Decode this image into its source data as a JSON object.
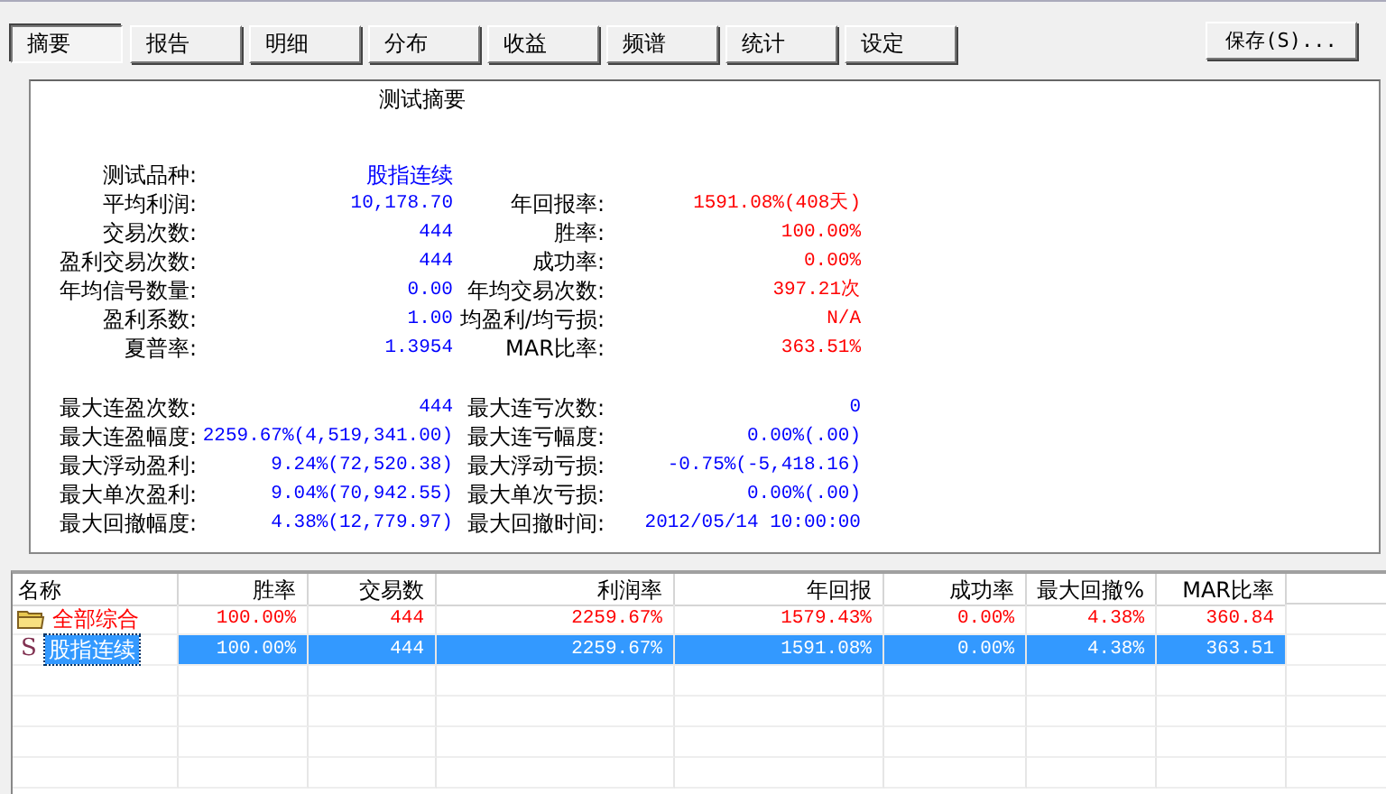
{
  "tabs": [
    {
      "label": "摘要",
      "selected": true
    },
    {
      "label": "报告",
      "selected": false
    },
    {
      "label": "明细",
      "selected": false
    },
    {
      "label": "分布",
      "selected": false
    },
    {
      "label": "收益",
      "selected": false
    },
    {
      "label": "频谱",
      "selected": false
    },
    {
      "label": "统计",
      "selected": false
    },
    {
      "label": "设定",
      "selected": false
    }
  ],
  "save_button": "保存(S)...",
  "summary": {
    "title": "测试摘要",
    "groups": [
      [
        [
          {
            "label": "测试品种:",
            "value": "股指连续",
            "color": "#0000ff"
          }
        ],
        [
          {
            "label": "平均利润:",
            "value": "10,178.70",
            "color": "#0000ff"
          },
          {
            "label": "年回报率:",
            "value": "1591.08%(408天)",
            "color": "#ff0000"
          }
        ],
        [
          {
            "label": "交易次数:",
            "value": "444",
            "color": "#0000ff"
          },
          {
            "label": "胜率:",
            "value": "100.00%",
            "color": "#ff0000"
          }
        ],
        [
          {
            "label": "盈利交易次数:",
            "value": "444",
            "color": "#0000ff"
          },
          {
            "label": "成功率:",
            "value": "0.00%",
            "color": "#ff0000"
          }
        ],
        [
          {
            "label": "年均信号数量:",
            "value": "0.00",
            "color": "#0000ff"
          },
          {
            "label": "年均交易次数:",
            "value": "397.21次",
            "color": "#ff0000"
          }
        ],
        [
          {
            "label": "盈利系数:",
            "value": "1.00",
            "color": "#0000ff"
          },
          {
            "label": "均盈利/均亏损:",
            "value": "N/A",
            "color": "#ff0000"
          }
        ],
        [
          {
            "label": "夏普率:",
            "value": "1.3954",
            "color": "#0000ff"
          },
          {
            "label": "MAR比率:",
            "value": "363.51%",
            "color": "#ff0000"
          }
        ]
      ],
      [
        [
          {
            "label": "最大连盈次数:",
            "value": "444",
            "color": "#0000ff"
          },
          {
            "label": "最大连亏次数:",
            "value": "0",
            "color": "#0000ff"
          }
        ],
        [
          {
            "label": "最大连盈幅度:",
            "value": "2259.67%(4,519,341.00)",
            "color": "#0000ff"
          },
          {
            "label": "最大连亏幅度:",
            "value": "0.00%(.00)",
            "color": "#0000ff"
          }
        ],
        [
          {
            "label": "最大浮动盈利:",
            "value": "9.24%(72,520.38)",
            "color": "#0000ff"
          },
          {
            "label": "最大浮动亏损:",
            "value": "-0.75%(-5,418.16)",
            "color": "#0000ff"
          }
        ],
        [
          {
            "label": "最大单次盈利:",
            "value": "9.04%(70,942.55)",
            "color": "#0000ff"
          },
          {
            "label": "最大单次亏损:",
            "value": "0.00%(.00)",
            "color": "#0000ff"
          }
        ],
        [
          {
            "label": "最大回撤幅度:",
            "value": "4.38%(12,779.97)",
            "color": "#0000ff"
          },
          {
            "label": "最大回撤时间:",
            "value": "2012/05/14 10:00:00",
            "color": "#0000ff"
          }
        ]
      ]
    ]
  },
  "table": {
    "columns": [
      "名称",
      "胜率",
      "交易数",
      "利润率",
      "年回报",
      "成功率",
      "最大回撤%",
      "MAR比率"
    ],
    "rows": [
      {
        "kind": "folder",
        "selected": false,
        "cells": [
          "全部综合",
          "100.00%",
          "444",
          "2259.67%",
          "1579.43%",
          "0.00%",
          "4.38%",
          "360.84"
        ]
      },
      {
        "kind": "strategy",
        "selected": true,
        "icon": "S",
        "cells": [
          "股指连续",
          "100.00%",
          "444",
          "2259.67%",
          "1591.08%",
          "0.00%",
          "4.38%",
          "363.51"
        ]
      }
    ]
  }
}
